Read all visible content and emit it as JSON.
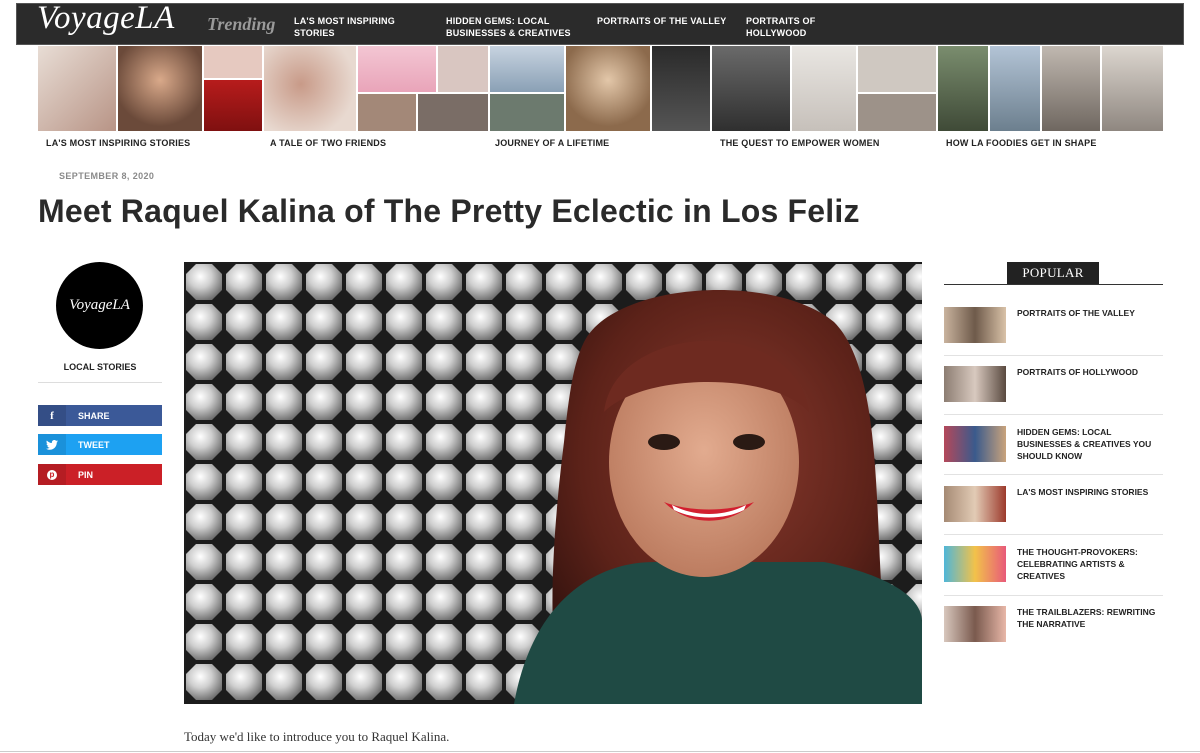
{
  "nav": {
    "logo": "VoyageLA",
    "trending": "Trending",
    "links": [
      "LA's Most Inspiring Stories",
      "Hidden Gems: Local Businesses & Creatives",
      "Portraits of the Valley",
      "Portraits of Hollywood"
    ]
  },
  "strip_captions": [
    "LA's Most Inspiring Stories",
    "A Tale of Two Friends",
    "Journey of a Lifetime",
    "The Quest to Empower Women",
    "How LA Foodies Get In Shape"
  ],
  "article": {
    "date": "September 8, 2020",
    "title": "Meet Raquel Kalina of The Pretty Eclectic in Los Feliz",
    "intro": "Today we'd like to introduce you to Raquel Kalina."
  },
  "author": {
    "avatar_text": "VoyageLA",
    "label": "Local Stories"
  },
  "share": {
    "facebook": "SHARE",
    "twitter": "TWEET",
    "pinterest": "PIN",
    "colors": {
      "facebook": "#3b5998",
      "twitter": "#1da1f2",
      "pinterest": "#cb2027"
    }
  },
  "popular": {
    "heading": "POPULAR",
    "items": [
      "Portraits of the Valley",
      "Portraits of Hollywood",
      "Hidden Gems: Local Businesses & Creatives You Should Know",
      "LA's Most Inspiring Stories",
      "The Thought-Provokers: Celebrating Artists & Creatives",
      "The Trailblazers: Rewriting the Narrative"
    ]
  }
}
